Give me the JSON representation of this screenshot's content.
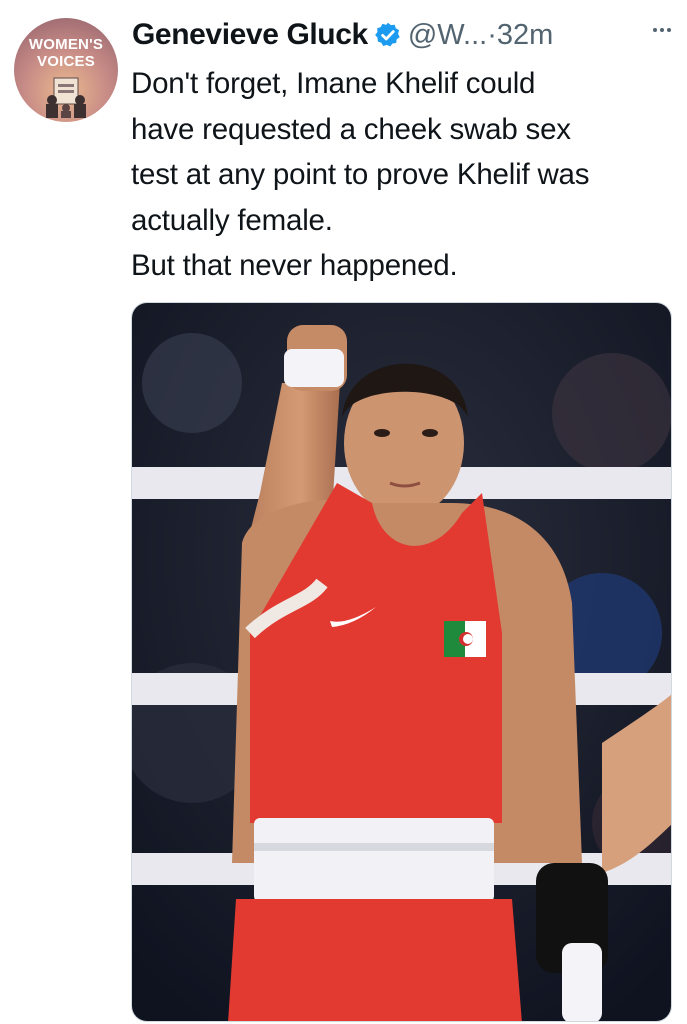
{
  "tweet": {
    "avatar": {
      "logo_line1": "WOMEN'S",
      "logo_line2": "VOICES",
      "icon": "womens-voices-logo"
    },
    "author_name": "Genevieve Gluck",
    "verified_icon": "verified-badge-icon",
    "handle": "@W...",
    "separator": "·",
    "time": "32m",
    "more_icon": "more-options-icon",
    "text_lines": [
      "Don't forget, Imane Khelif could",
      "have requested a cheek swab sex",
      "test at any point to prove Khelif was",
      "actually female.",
      "But that never happened."
    ],
    "media": {
      "type": "photo",
      "subject": "boxer-raising-fist-in-ring"
    }
  },
  "colors": {
    "text": "#0f1419",
    "secondary": "#536471",
    "verified": "#1d9bf0",
    "jersey": "#e23a31"
  }
}
